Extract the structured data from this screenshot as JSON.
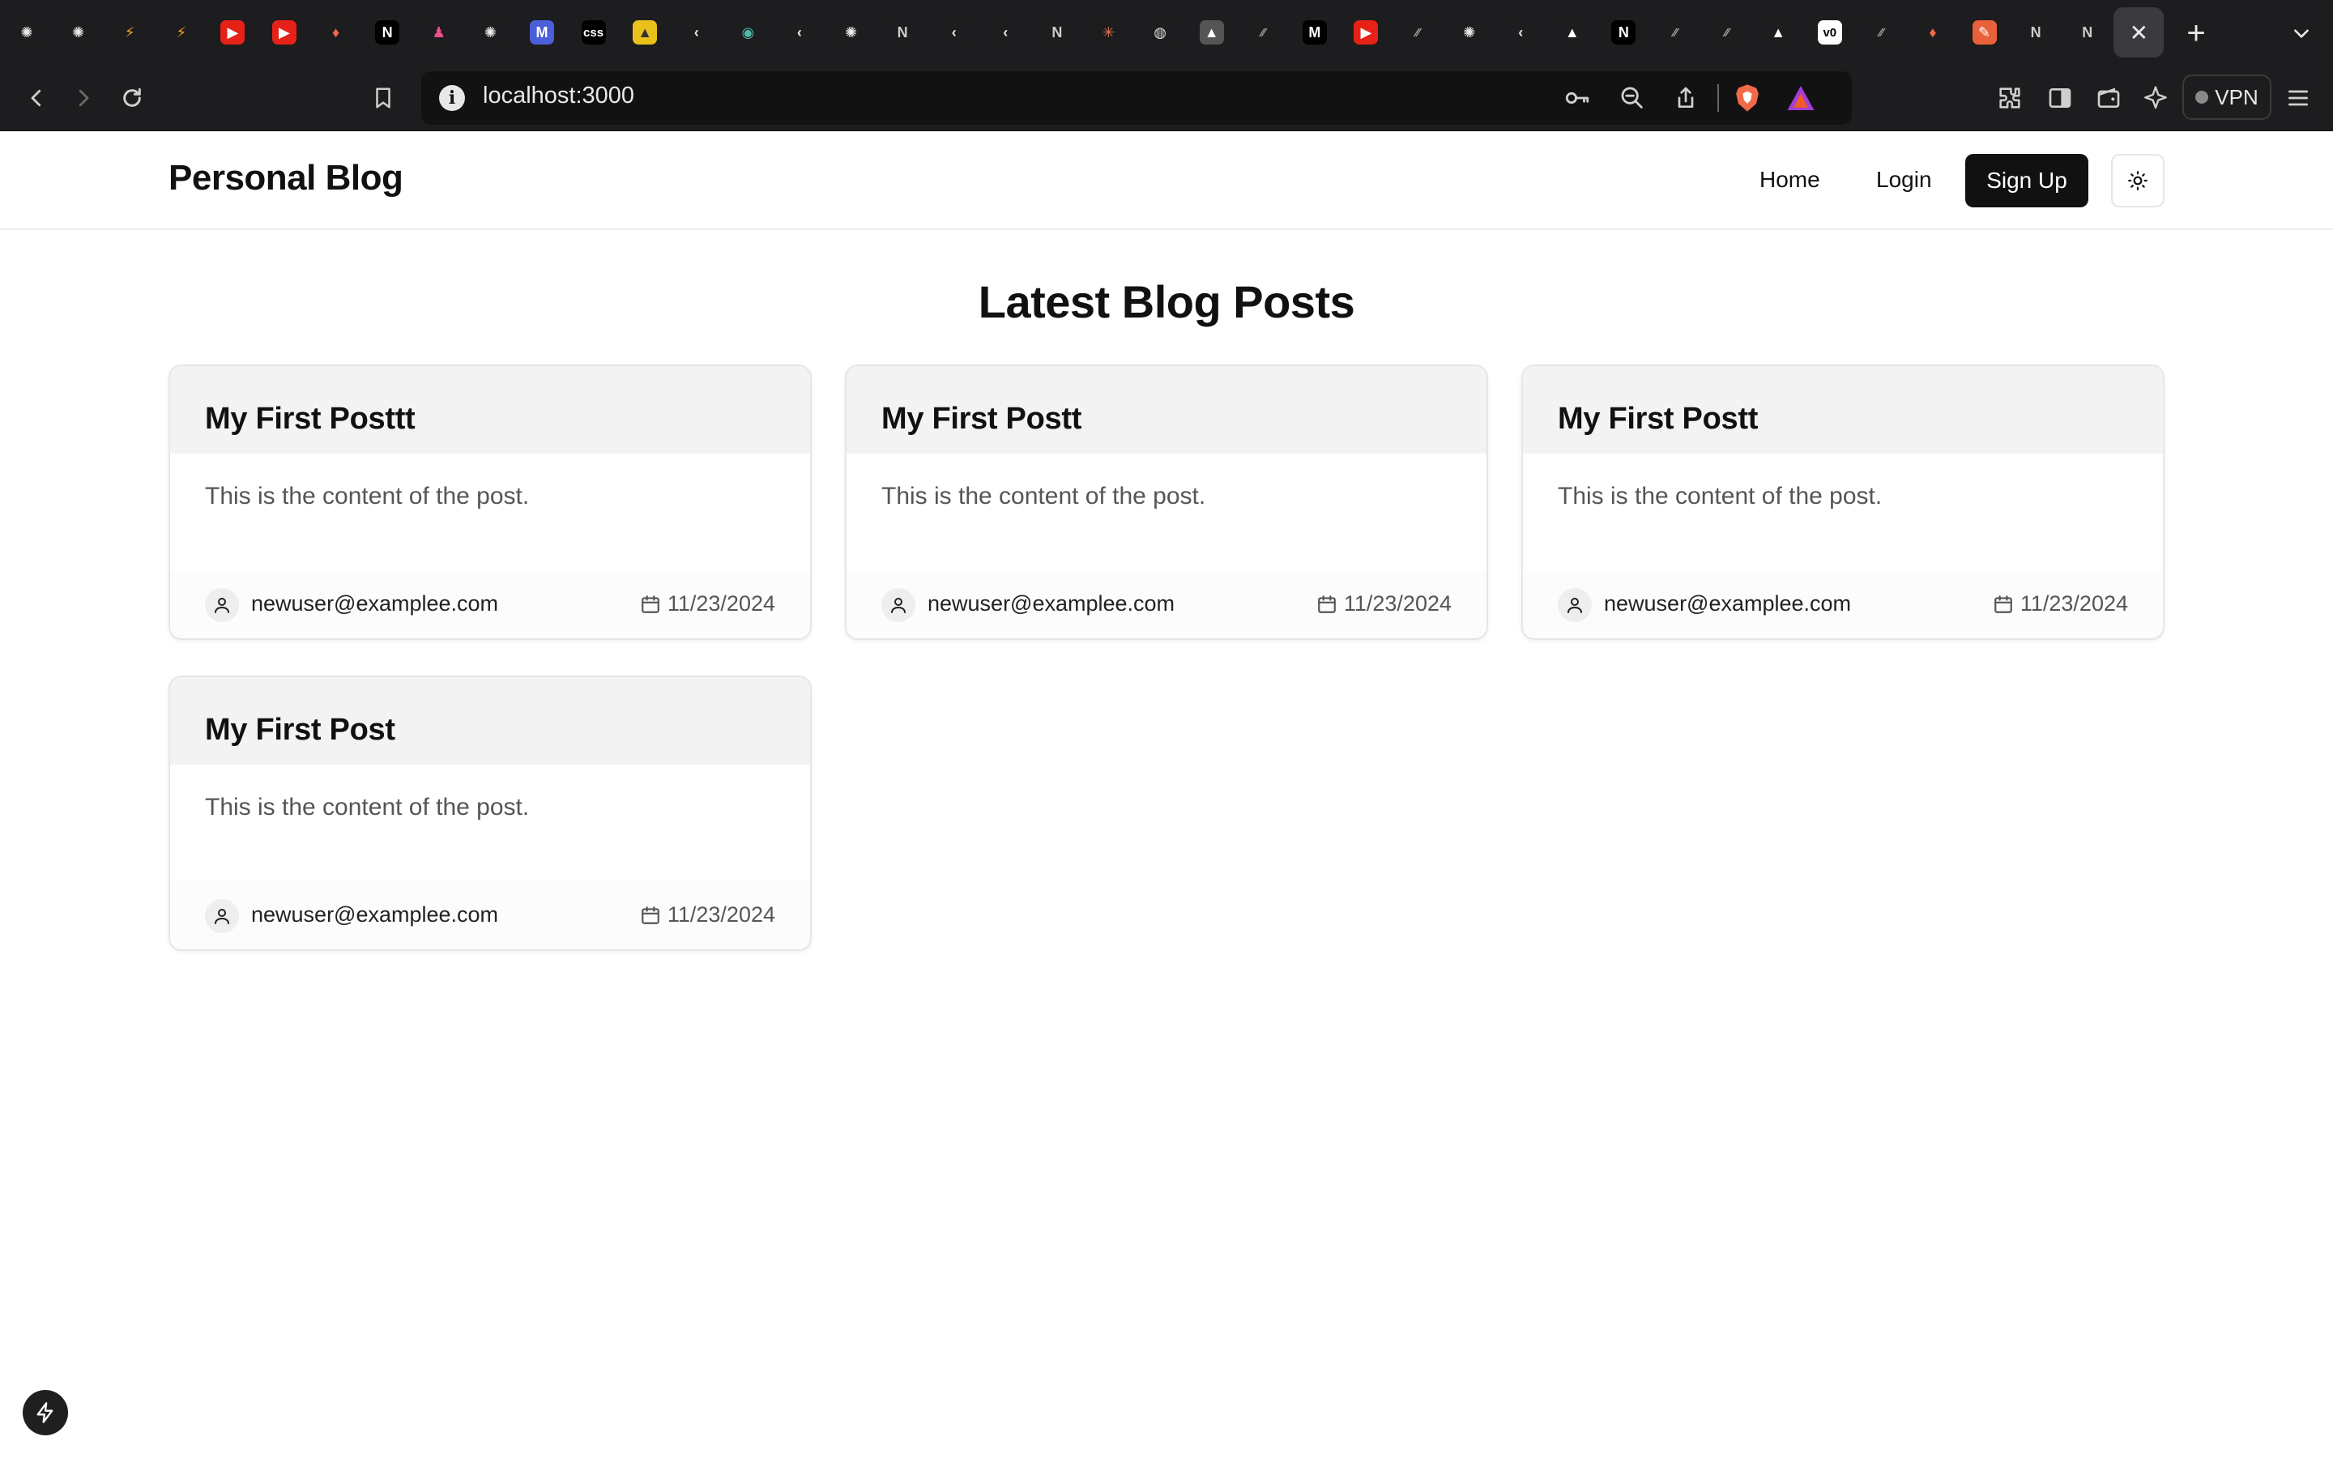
{
  "browser": {
    "tabs": [
      {
        "icon": "chatgpt-icon",
        "glyph": "✺",
        "bg": "#1d1d1f",
        "fg": "#e8e8e8"
      },
      {
        "icon": "chatgpt-icon",
        "glyph": "✺",
        "bg": "#1d1d1f",
        "fg": "#e8e8e8"
      },
      {
        "icon": "lightning-stack-icon",
        "glyph": "⚡",
        "bg": "#1d1d1f",
        "fg": "#f5a623"
      },
      {
        "icon": "lightning-stack-icon",
        "glyph": "⚡",
        "bg": "#1d1d1f",
        "fg": "#f5a623"
      },
      {
        "icon": "youtube-icon",
        "glyph": "▶",
        "bg": "#e62117",
        "fg": "#ffffff"
      },
      {
        "icon": "youtube-icon",
        "glyph": "▶",
        "bg": "#e62117",
        "fg": "#ffffff"
      },
      {
        "icon": "brave-shield-icon",
        "glyph": "♦",
        "bg": "#1d1d1f",
        "fg": "#f06a4a"
      },
      {
        "icon": "nextjs-icon",
        "glyph": "N",
        "bg": "#000000",
        "fg": "#ffffff"
      },
      {
        "icon": "shoe-icon",
        "glyph": "♟",
        "bg": "#1d1d1f",
        "fg": "#e8508a"
      },
      {
        "icon": "chatgpt-icon",
        "glyph": "✺",
        "bg": "#1d1d1f",
        "fg": "#e8e8e8"
      },
      {
        "icon": "m-badge-icon",
        "glyph": "M",
        "bg": "#4b5fd8",
        "fg": "#ffffff"
      },
      {
        "icon": "css-icon",
        "glyph": "css",
        "bg": "#000000",
        "fg": "#ffffff"
      },
      {
        "icon": "yellow-image-icon",
        "glyph": "▲",
        "bg": "#e8c21a",
        "fg": "#333333"
      },
      {
        "icon": "chevron-logo-icon",
        "glyph": "‹",
        "bg": "#1d1d1f",
        "fg": "#e8e8e8"
      },
      {
        "icon": "eye-icon",
        "glyph": "◉",
        "bg": "#1d1d1f",
        "fg": "#4fb8a8"
      },
      {
        "icon": "chevron-logo-icon",
        "glyph": "‹",
        "bg": "#1d1d1f",
        "fg": "#e8e8e8"
      },
      {
        "icon": "chatgpt-icon",
        "glyph": "✺",
        "bg": "#1d1d1f",
        "fg": "#e8e8e8"
      },
      {
        "icon": "notion-icon",
        "glyph": "N",
        "bg": "#1d1d1f",
        "fg": "#cccccc"
      },
      {
        "icon": "chevron-logo-icon",
        "glyph": "‹",
        "bg": "#1d1d1f",
        "fg": "#e8e8e8"
      },
      {
        "icon": "chevron-logo-icon",
        "glyph": "‹",
        "bg": "#1d1d1f",
        "fg": "#e8e8e8"
      },
      {
        "icon": "notion-icon",
        "glyph": "N",
        "bg": "#1d1d1f",
        "fg": "#cccccc"
      },
      {
        "icon": "claude-icon",
        "glyph": "✳",
        "bg": "#1d1d1f",
        "fg": "#e07a4f"
      },
      {
        "icon": "globe-icon",
        "glyph": "◍",
        "bg": "#1d1d1f",
        "fg": "#dddddd"
      },
      {
        "icon": "triangle-icon",
        "glyph": "▲",
        "bg": "#555555",
        "fg": "#ffffff"
      },
      {
        "icon": "slash-icon",
        "glyph": "⁄⁄",
        "bg": "#1d1d1f",
        "fg": "#aaaaaa"
      },
      {
        "icon": "medium-icon",
        "glyph": "M",
        "bg": "#000000",
        "fg": "#ffffff"
      },
      {
        "icon": "youtube-icon",
        "glyph": "▶",
        "bg": "#e62117",
        "fg": "#ffffff"
      },
      {
        "icon": "slash-icon",
        "glyph": "⁄⁄",
        "bg": "#1d1d1f",
        "fg": "#aaaaaa"
      },
      {
        "icon": "chatgpt-icon",
        "glyph": "✺",
        "bg": "#1d1d1f",
        "fg": "#e8e8e8"
      },
      {
        "icon": "chevron-logo-icon",
        "glyph": "‹",
        "bg": "#1d1d1f",
        "fg": "#e8e8e8"
      },
      {
        "icon": "vercel-icon",
        "glyph": "▲",
        "bg": "#1d1d1f",
        "fg": "#ffffff"
      },
      {
        "icon": "nextjs-icon",
        "glyph": "N",
        "bg": "#000000",
        "fg": "#ffffff"
      },
      {
        "icon": "slash-icon",
        "glyph": "⁄⁄",
        "bg": "#1d1d1f",
        "fg": "#aaaaaa"
      },
      {
        "icon": "slash-icon",
        "glyph": "⁄⁄",
        "bg": "#1d1d1f",
        "fg": "#aaaaaa"
      },
      {
        "icon": "vercel-icon",
        "glyph": "▲",
        "bg": "#1d1d1f",
        "fg": "#ffffff"
      },
      {
        "icon": "v0-icon",
        "glyph": "v0",
        "bg": "#ffffff",
        "fg": "#000000"
      },
      {
        "icon": "slash-icon",
        "glyph": "⁄⁄",
        "bg": "#1d1d1f",
        "fg": "#aaaaaa"
      },
      {
        "icon": "brave-shield-icon",
        "glyph": "♦",
        "bg": "#1d1d1f",
        "fg": "#f06a4a"
      },
      {
        "icon": "orange-rocket-icon",
        "glyph": "✎",
        "bg": "#e8613a",
        "fg": "#ffffff"
      },
      {
        "icon": "notion-icon",
        "glyph": "N",
        "bg": "#1d1d1f",
        "fg": "#cccccc"
      },
      {
        "icon": "notion-icon",
        "glyph": "N",
        "bg": "#1d1d1f",
        "fg": "#cccccc"
      },
      {
        "icon": "close-icon",
        "glyph": "✕",
        "bg": "transparent",
        "fg": "#e8e8e8",
        "active": true
      }
    ],
    "url": "localhost:3000",
    "vpn_label": "VPN"
  },
  "site": {
    "brand": "Personal Blog",
    "nav": {
      "home": "Home",
      "login": "Login",
      "signup": "Sign Up"
    },
    "page_title": "Latest Blog Posts",
    "posts": [
      {
        "title": "My First Posttt",
        "content": "This is the content of the post.",
        "author": "newuser@examplee.com",
        "date": "11/23/2024"
      },
      {
        "title": "My First Postt",
        "content": "This is the content of the post.",
        "author": "newuser@examplee.com",
        "date": "11/23/2024"
      },
      {
        "title": "My First Postt",
        "content": "This is the content of the post.",
        "author": "newuser@examplee.com",
        "date": "11/23/2024"
      },
      {
        "title": "My First Post",
        "content": "This is the content of the post.",
        "author": "newuser@examplee.com",
        "date": "11/23/2024"
      }
    ]
  },
  "colors": {
    "chrome_bg": "#1d1d1f",
    "primary_button": "#111111",
    "card_header": "#f3f3f3",
    "muted_text": "#555555"
  }
}
